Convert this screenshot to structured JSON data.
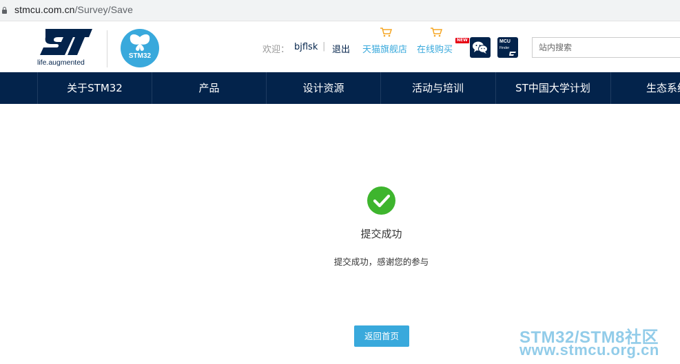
{
  "browser": {
    "url_host": "stmcu.com.cn",
    "url_path": "/Survey/Save"
  },
  "header": {
    "st_tagline": "life.augmented",
    "stm32_logo_text": "STM32",
    "welcome_label": "欢迎：",
    "username": "bjflsk",
    "separator": "|",
    "logout": "退出",
    "tmall_store": "天猫旗舰店",
    "online_shop": "在线购买",
    "new_badge": "NEW",
    "mcu_finder_line1": "MCU",
    "mcu_finder_line2": "Finder",
    "search_placeholder": "站内搜索"
  },
  "nav": {
    "items": [
      {
        "label": "关于STM32"
      },
      {
        "label": "产品"
      },
      {
        "label": "设计资源"
      },
      {
        "label": "活动与培训"
      },
      {
        "label": "ST中国大学计划"
      },
      {
        "label": "生态系统"
      }
    ]
  },
  "result": {
    "title": "提交成功",
    "message": "提交成功，感谢您的参与",
    "home_button": "返回首页"
  },
  "watermark": {
    "line1": "STM32/STM8社区",
    "line2": "www.stmcu.org.cn"
  },
  "colors": {
    "nav_bg": "#03234b",
    "accent": "#39a9dc",
    "success": "#3eb52e"
  }
}
